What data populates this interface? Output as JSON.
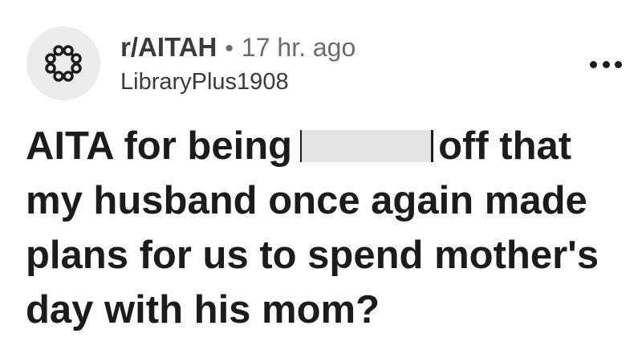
{
  "post": {
    "subreddit": "r/AITAH",
    "separator": "•",
    "time_ago": "17 hr. ago",
    "username": "LibraryPlus1908",
    "title": {
      "line1_before": "AITA for being",
      "line1_after": "off that",
      "line2": "my husband once again made",
      "line3": "plans for us to spend mother's",
      "line4": "day with his mom?"
    }
  },
  "icons": {
    "avatar": "subreddit-avatar-icon",
    "menu": "more-options-icon"
  },
  "colors": {
    "avatar_bg": "#ececec",
    "text_primary": "#1c1c1c",
    "text_secondary": "#6b6b6b",
    "redaction": "#e3e3e3"
  }
}
